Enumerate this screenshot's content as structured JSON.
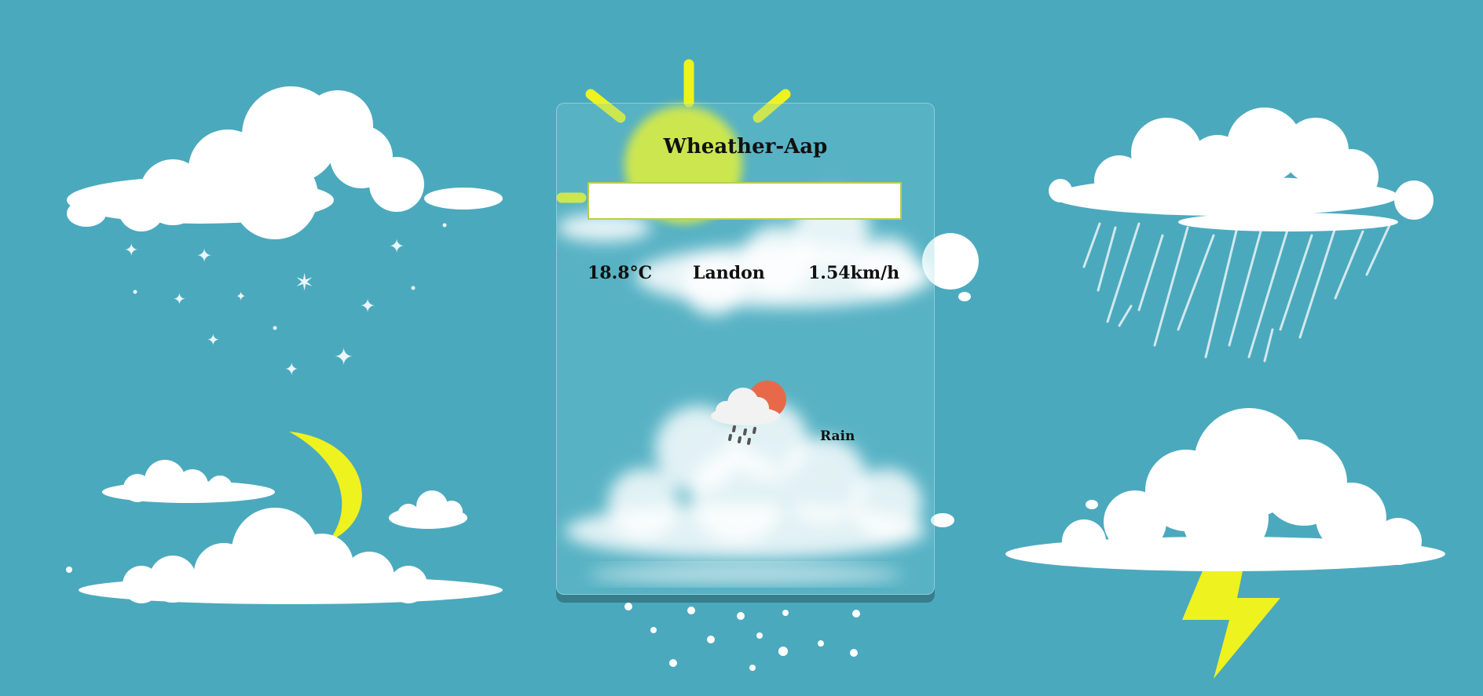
{
  "app": {
    "title": "Wheather-Aap"
  },
  "search": {
    "value": "",
    "placeholder": ""
  },
  "weather": {
    "temperature": "18.8°C",
    "city": "Landon",
    "wind_speed": "1.54km/h",
    "description": "Rain",
    "icon": "rain-cloud-sun-icon"
  },
  "colors": {
    "background": "#4ba9bd",
    "cloud": "#ffffff",
    "accent_yellow": "#eef21e",
    "sun_orange": "#e8694a"
  }
}
